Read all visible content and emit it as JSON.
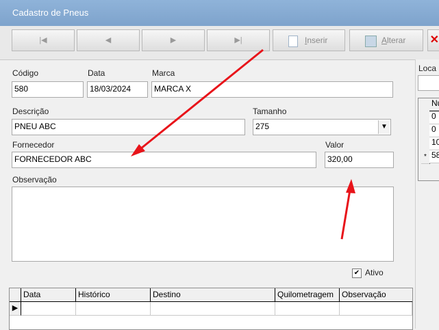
{
  "window": {
    "title": "Cadastro de Pneus"
  },
  "toolbar": {
    "nav": [
      "|◀",
      "◀",
      "▶",
      "▶|"
    ],
    "insert_prefix": "I",
    "insert_rest": "nserir",
    "edit_prefix": "A",
    "edit_rest": "lterar",
    "close_glyph": "✕"
  },
  "form": {
    "codigo_label": "Código",
    "codigo_value": "580",
    "data_label": "Data",
    "data_value": "18/03/2024",
    "marca_label": "Marca",
    "marca_value": "MARCA X",
    "descricao_label": "Descrição",
    "descricao_value": "PNEU ABC",
    "tamanho_label": "Tamanho",
    "tamanho_value": "275",
    "fornecedor_label": "Fornecedor",
    "fornecedor_value": "FORNECEDOR ABC",
    "valor_label": "Valor",
    "valor_value": "320,00",
    "observacao_label": "Observação",
    "ativo_label": "Ativo",
    "ativo_checked": true
  },
  "history_grid": {
    "columns": [
      "Data",
      "Histórico",
      "Destino",
      "Quilometragem",
      "Observação"
    ]
  },
  "right_panel": {
    "label": "Loca",
    "header": "Nu",
    "rows": [
      {
        "indicator": "",
        "value": "0"
      },
      {
        "indicator": "",
        "value": "0"
      },
      {
        "indicator": "",
        "value": "10"
      },
      {
        "indicator": "*",
        "value": "58"
      }
    ]
  },
  "annotation_color": "#e8141a"
}
